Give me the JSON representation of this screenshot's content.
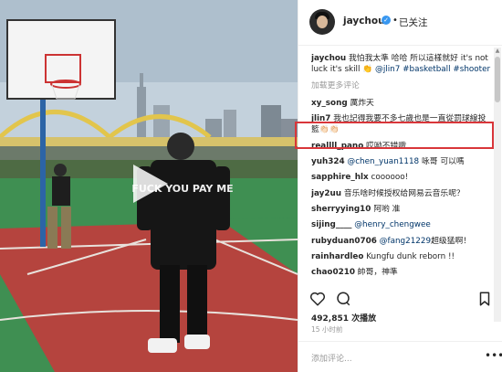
{
  "post": {
    "username": "jaychou",
    "verified_mark": "✓",
    "separator": "•",
    "follow_status": "已关注"
  },
  "caption": {
    "user": "jaychou",
    "text_1": " 我怕我太準 哈哈 所以這樣就好 it's not luck it's skill ",
    "emoji": "👏",
    "mention": "@jlin7",
    "hashtag_1": "#basketball",
    "hashtag_2": "#shooter"
  },
  "load_more": "加载更多评论",
  "comments": [
    {
      "user": "xy_song",
      "text": " 厲炸天"
    },
    {
      "user": "jlin7",
      "text": " 我也記得我要不多七歲也是一直從罰球線投籃👏🏻👏🏻"
    },
    {
      "user": "reallll_pano",
      "text": " 哎呦不错哦"
    },
    {
      "user": "yuh324",
      "mention": "@chen_yuan1118",
      "text": " 咏哥 可以嗎"
    },
    {
      "user": "sapphire_hlx",
      "text": " coooooo!"
    },
    {
      "user": "jay2uu",
      "text": " 音乐啥时候授权给网易云音乐呢？"
    },
    {
      "user": "sherryying10",
      "text": " 阿哟 准"
    },
    {
      "user": "sijing____",
      "mention": "@henry_chengwee",
      "text": ""
    },
    {
      "user": "rubyduan0706",
      "mention": "@fang21229",
      "text": "超级猛啊！"
    },
    {
      "user": "rainhardleo",
      "text": " Kungfu dunk reborn !!"
    },
    {
      "user": "chao0210",
      "text": " 帥哥，神準"
    }
  ],
  "stats": {
    "views": "492,851 次播放",
    "time": "15 小时前"
  },
  "add_comment": {
    "placeholder": "添加评论...",
    "options": "•••"
  },
  "video": {
    "shirt_text": "FUCK YOU PAY ME"
  },
  "colors": {
    "highlight_border": "#d9363a",
    "verified": "#3897f0",
    "link": "#003569",
    "court_red": "#b5443e",
    "court_green": "#3f8f52"
  },
  "icons": [
    "play-icon",
    "heart-icon",
    "comment-icon",
    "bookmark-icon",
    "options-icon"
  ]
}
